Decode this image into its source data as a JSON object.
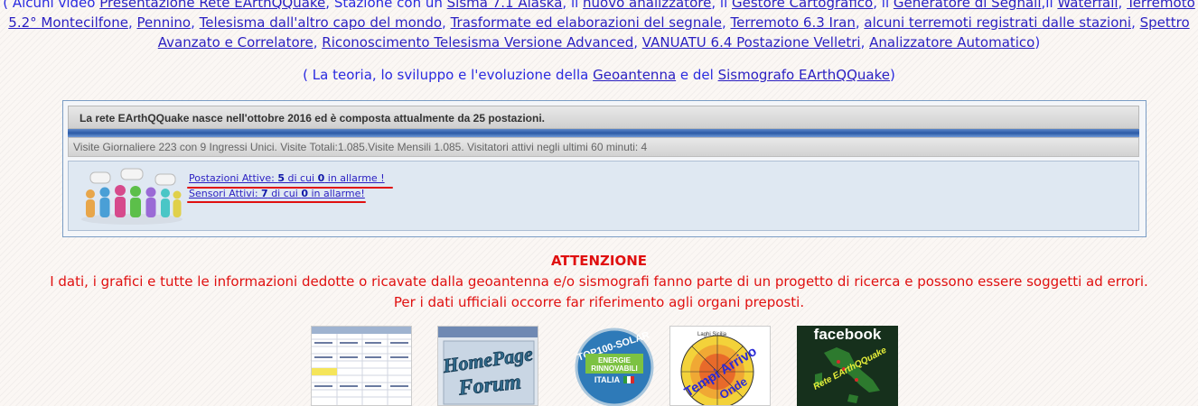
{
  "links": {
    "line1_prefix": "( Alcuni video ",
    "line1_items": [
      "Presentazione Rete EArthQQuake",
      "Stazione con un ",
      "Sisma 7.1 Alaska",
      "il ",
      "nuovo analizzatore",
      "il ",
      "Gestore Cartografico",
      "il ",
      "Generatore di Segnali",
      "il ",
      "Waterfall",
      "Terremoto"
    ],
    "line2": [
      "5.2° Montecilfone",
      "Pennino",
      "Telesisma dall'altro capo del mondo",
      "Trasformate ed elaborazioni del segnale",
      "Terremoto 6.3 Iran",
      "alcuni terremoti registrati dalle stazioni",
      "Spettro"
    ],
    "line3": [
      "Avanzato e Correlatore",
      "Riconoscimento Telesisma Versione Advanced",
      "VANUATU 6.4 Postazione Velletri",
      "Analizzatore Automatico"
    ],
    "line3_suffix": ")"
  },
  "theory": {
    "prefix": "( La teoria, lo sviluppo e l'evoluzione della ",
    "link1": "Geoantenna",
    "middle": " e del ",
    "link2": "Sismografo EArthQQuake",
    "suffix": ")"
  },
  "network": {
    "header": "La rete EArthQQuake nasce nell'ottobre 2016 ed è composta attualmente da 25 postazioni.",
    "visits": "Visite Giornaliere 223 con 9 Ingressi Unici. Visite Totali:1.085.Visite Mensili 1.085. Visitatori attivi negli ultimi 60 minuti: 4",
    "stations": {
      "label": "Postazioni Attive: ",
      "active": "5",
      "mid": " di cui ",
      "alarm": "0",
      "suffix": "  in allarme !"
    },
    "sensors": {
      "label": "Sensori Attivi: ",
      "active": "7",
      "mid": " di cui ",
      "alarm": "0",
      "suffix": "  in allarme!"
    }
  },
  "notice": {
    "title": "ATTENZIONE",
    "line1": "I dati, i grafici e tutte le informazioni dedotte o ricavate dalla geoantenna e/o sismografi fanno parte di un progetto di ricerca e possono essere soggetti ad errori.",
    "line2": "Per i dati ufficiali occorre far riferimento agli organi preposti."
  },
  "banners": {
    "homepage_forum_1": "HomePage",
    "homepage_forum_2": "Forum",
    "top100_1": "TOP100-SOLAR",
    "top100_2": "ENERGIE",
    "top100_3": "RINNOVABILI",
    "top100_4": "ITALIA",
    "tempi_1": "Tempi Arrivo",
    "tempi_2": "Onde",
    "tempi_3": "Laghi Sicilia",
    "facebook_1": "facebook",
    "facebook_2": "Rete EArthQQuake"
  },
  "colors": {
    "link": "#2a1fc2",
    "warning": "#e01010",
    "panel": "#dfe8f2"
  }
}
